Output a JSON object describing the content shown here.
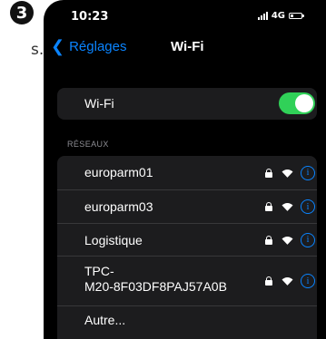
{
  "step": {
    "number": "3"
  },
  "side_text": "s.",
  "status_bar": {
    "time": "10:23",
    "network": "4G",
    "battery_fraction": 0.25
  },
  "nav": {
    "back_label": "Réglages",
    "title": "Wi-Fi"
  },
  "wifi": {
    "label": "Wi-Fi",
    "enabled": true
  },
  "networks_section": {
    "header": "RÉSEAUX",
    "items": [
      {
        "name": "europarm01",
        "locked": true
      },
      {
        "name": "europarm03",
        "locked": true
      },
      {
        "name": "Logistique",
        "locked": true
      },
      {
        "name": "TPC-\nM20-8F03DF8PAJ57A0B",
        "locked": true
      }
    ],
    "other_label": "Autre..."
  },
  "colors": {
    "accent": "#0a84ff",
    "toggle_on": "#30d158",
    "row_bg": "#1c1c1e"
  },
  "icons": {
    "lock": "lock-icon",
    "wifi": "wifi-icon",
    "info": "info-icon"
  }
}
